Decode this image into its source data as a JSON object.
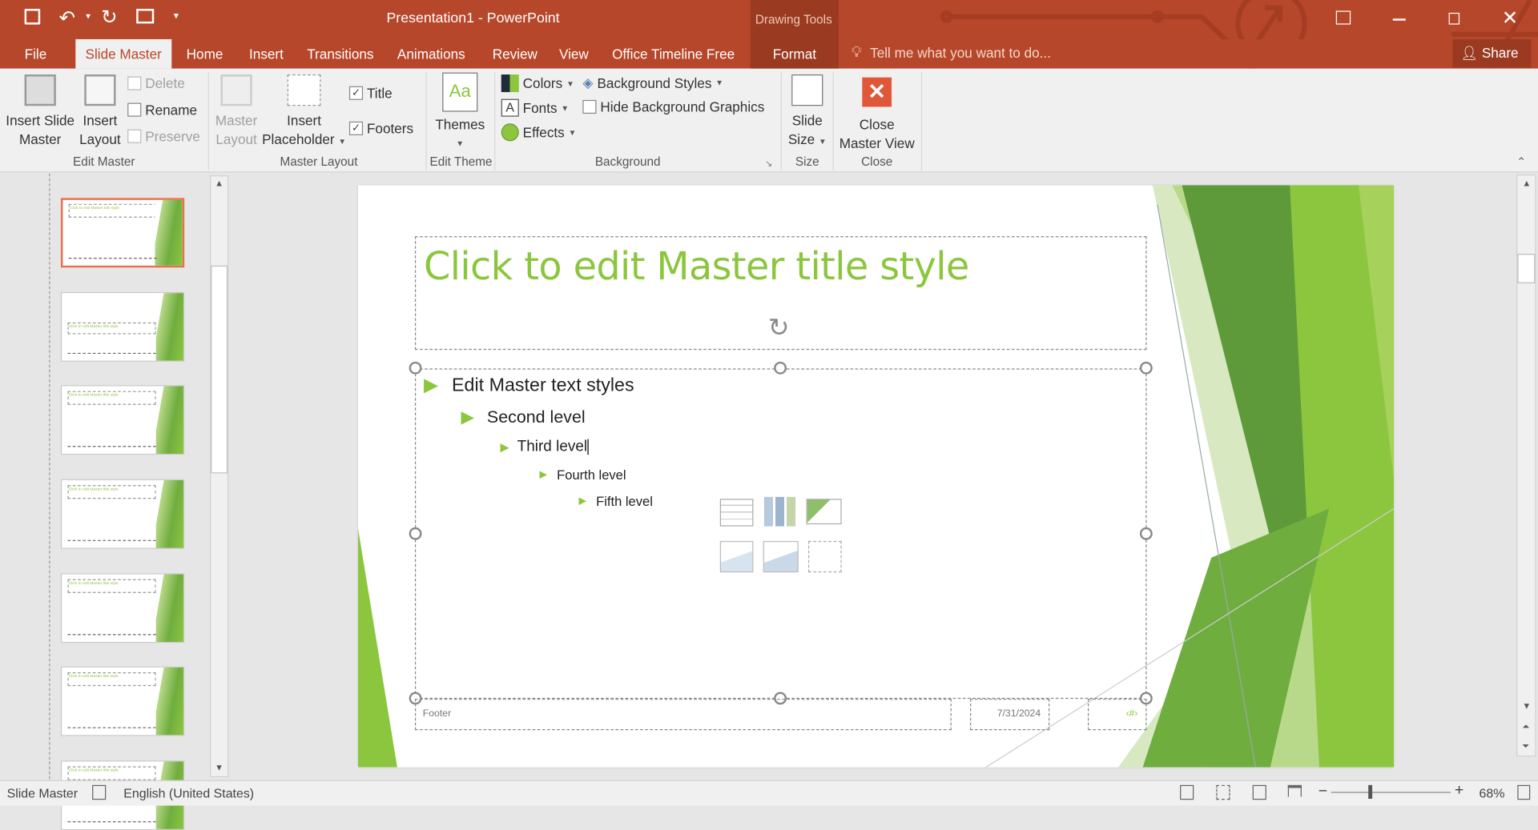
{
  "window": {
    "title": "Presentation1 - PowerPoint",
    "context_group": "Drawing Tools"
  },
  "qat": {
    "customize": "▾"
  },
  "tabs": [
    {
      "label": "File"
    },
    {
      "label": "Slide Master"
    },
    {
      "label": "Home"
    },
    {
      "label": "Insert"
    },
    {
      "label": "Transitions"
    },
    {
      "label": "Animations"
    },
    {
      "label": "Review"
    },
    {
      "label": "View"
    },
    {
      "label": "Office Timeline Free"
    },
    {
      "label": "Format"
    }
  ],
  "tell_me": "Tell me what you want to do...",
  "share": "Share",
  "ribbon": {
    "edit_master": {
      "label": "Edit Master",
      "insert_slide_master": [
        "Insert Slide",
        "Master"
      ],
      "insert_layout": [
        "Insert",
        "Layout"
      ],
      "delete": "Delete",
      "rename": "Rename",
      "preserve": "Preserve"
    },
    "master_layout": {
      "label": "Master Layout",
      "master_layout": [
        "Master",
        "Layout"
      ],
      "insert_placeholder": [
        "Insert",
        "Placeholder"
      ],
      "title": "Title",
      "footers": "Footers",
      "title_checked": true,
      "footers_checked": true
    },
    "edit_theme": {
      "label": "Edit Theme",
      "themes": "Themes"
    },
    "background": {
      "label": "Background",
      "colors": "Colors",
      "fonts": "Fonts",
      "effects": "Effects",
      "background_styles": "Background Styles",
      "hide_bg": "Hide Background Graphics",
      "hide_bg_checked": false
    },
    "size": {
      "label": "Size",
      "slide_size": [
        "Slide",
        "Size"
      ]
    },
    "close": {
      "label": "Close",
      "close_master": [
        "Close",
        "Master View"
      ]
    }
  },
  "slide": {
    "title": "Click to edit Master title style",
    "levels": [
      "Edit Master text styles",
      "Second level",
      "Third level",
      "Fourth level",
      "Fifth level"
    ],
    "footer": "Footer",
    "date": "7/31/2024",
    "number": "‹#›"
  },
  "thumbnails": {
    "count": 7,
    "selected": 0,
    "caption": "Click to edit Master title style"
  },
  "status": {
    "view": "Slide Master",
    "language": "English (United States)",
    "zoom": "68%",
    "zoom_percent": 68
  },
  "colors": {
    "accent": "#b7472a",
    "green": "#8cc63f"
  }
}
